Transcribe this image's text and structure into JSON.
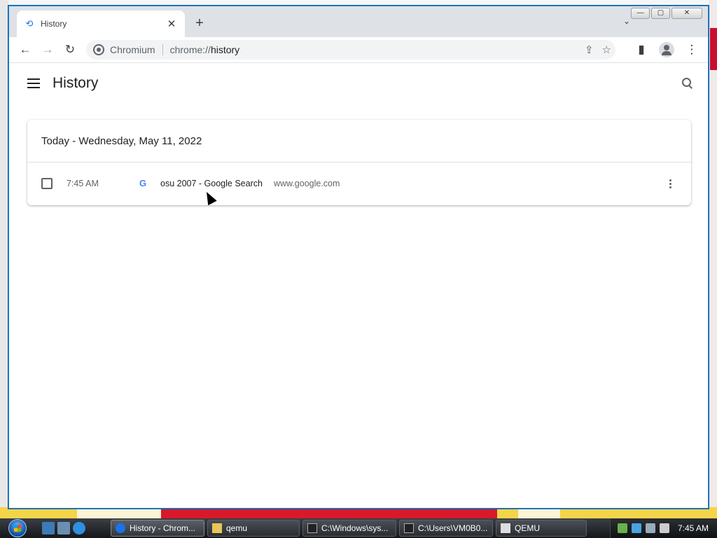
{
  "browser": {
    "tab_title": "History",
    "tab_close": "✕",
    "new_tab": "+",
    "tab_search": "⌄",
    "site_label": "Chromium",
    "url_prefix": "chrome://",
    "url_path": "history",
    "window_buttons": {
      "minimize": "—",
      "maximize": "▢",
      "close": "✕"
    }
  },
  "history": {
    "title": "History",
    "date_header": "Today - Wednesday, May 11, 2022",
    "entries": [
      {
        "time": "7:45 AM",
        "title": "osu 2007 - Google Search",
        "domain": "www.google.com",
        "favicon": "G"
      }
    ]
  },
  "taskbar": {
    "tasks": [
      {
        "label": "History - Chrom...",
        "icon": "chromium-icon",
        "active": true
      },
      {
        "label": "qemu",
        "icon": "folder-icon",
        "active": false
      },
      {
        "label": "C:\\Windows\\sys...",
        "icon": "cmd-icon",
        "active": false
      },
      {
        "label": "C:\\Users\\VM0B0...",
        "icon": "cmd-icon",
        "active": false
      },
      {
        "label": "QEMU",
        "icon": "qemu-icon",
        "active": false
      }
    ],
    "clock": "7:45 AM"
  },
  "colors": {
    "accent": "#1a73e8",
    "toolbar_bg": "#dee1e6",
    "omnibox_bg": "#f1f3f4"
  }
}
